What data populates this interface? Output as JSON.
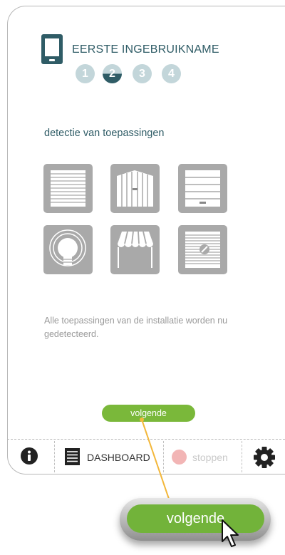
{
  "header": {
    "title": "EERSTE INGEBRUIKNAME",
    "phone_icon": "smartphone-icon",
    "steps": [
      "1",
      "2",
      "3",
      "4"
    ],
    "active_step": "2"
  },
  "main": {
    "section_title": "detectie van toepassingen",
    "applications": [
      {
        "icon": "roller-shutter-icon"
      },
      {
        "icon": "gate-icon"
      },
      {
        "icon": "garage-door-icon"
      },
      {
        "icon": "light-bulb-icon"
      },
      {
        "icon": "awning-icon"
      },
      {
        "icon": "venetian-blind-icon"
      }
    ],
    "description": "Alle toepassingen van de installatie worden nu gedetecteerd.",
    "next_button": "volgende"
  },
  "toolbar": {
    "info_icon": "info-icon",
    "dashboard_label": "DASHBOARD",
    "stop_label": "stoppen",
    "settings_icon": "gear-icon"
  },
  "callout": {
    "button_label": "volgende"
  },
  "colors": {
    "accent": "#2f5c66",
    "step_inactive": "#c3d6da",
    "button_green": "#7ab83a",
    "tile_gray": "#a9a9a9",
    "stop_pink": "#f2b5b5",
    "callout_line": "#f3b73a"
  }
}
